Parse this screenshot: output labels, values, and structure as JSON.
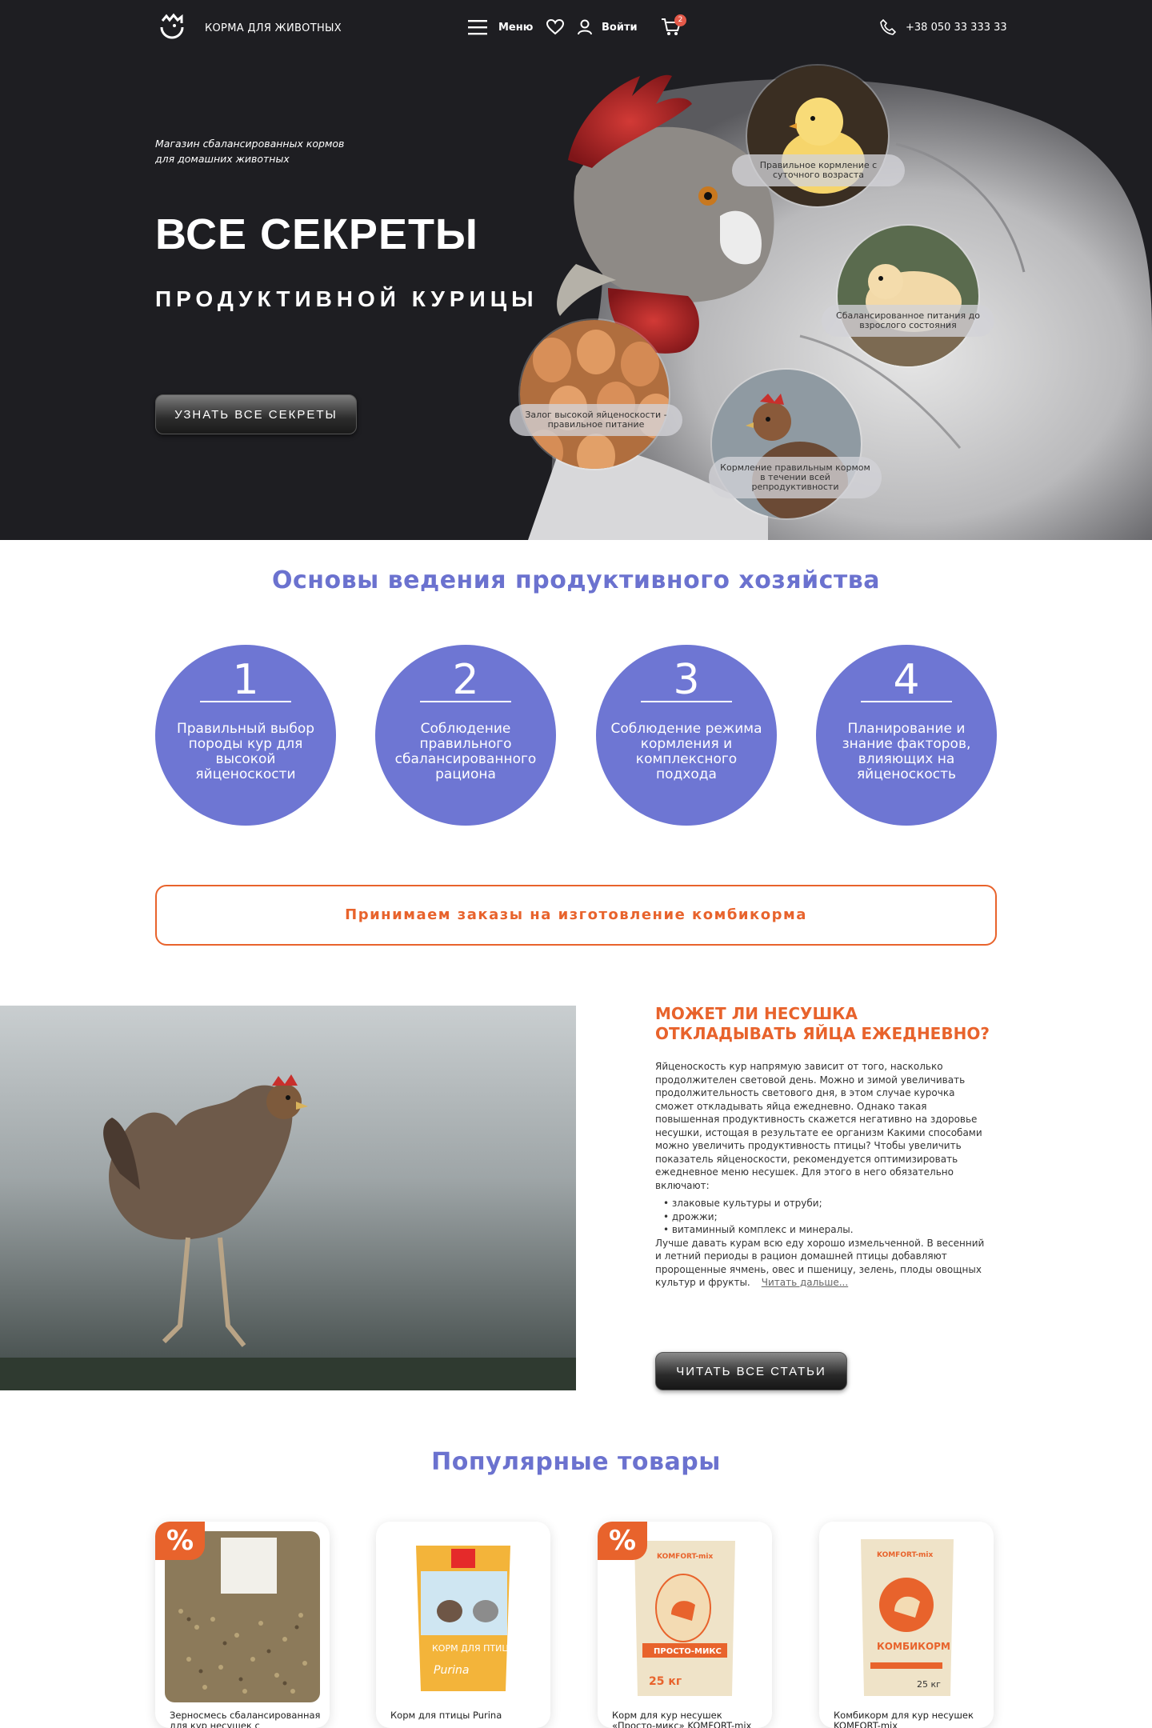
{
  "header": {
    "logo_text": "КОРМА ДЛЯ ЖИВОТНЫХ",
    "menu_label": "Меню",
    "login_label": "Войти",
    "cart_count": "2",
    "phone": "+38 050 33 333 33"
  },
  "hero": {
    "tagline": "Магазин сбалансированных кормов для домашних животных",
    "title": "ВСЕ СЕКРЕТЫ",
    "subtitle": "ПРОДУКТИВНОЙ КУРИЦЫ",
    "button": "УЗНАТЬ ВСЕ СЕКРЕТЫ",
    "bubbles": [
      "Правильное кормление с суточного возраста",
      "Сбалансированное питания до взрослого состояния",
      "Залог высокой яйценоскости - правильное питание",
      "Кормление правильным кормом в течении всей репродуктивности"
    ]
  },
  "basics": {
    "title": "Основы ведения продуктивного хозяйства",
    "steps": [
      {
        "num": "1",
        "text": "Правильный выбор породы кур для высокой яйценоскости"
      },
      {
        "num": "2",
        "text": "Соблюдение правильного сбалансированного рациона"
      },
      {
        "num": "3",
        "text": "Соблюдение режима кормления и комплексного подхода"
      },
      {
        "num": "4",
        "text": "Планирование и знание факторов, влияющих на яйценоскость"
      }
    ]
  },
  "orders_banner": "Принимаем заказы на изготовление комбикорма",
  "article": {
    "title": "МОЖЕТ ЛИ НЕСУШКА ОТКЛАДЫВАТЬ ЯЙЦА ЕЖЕДНЕВНО?",
    "p1": "Яйценоскость кур напрямую зависит от того, насколько продолжителен световой день. Можно и зимой увеличивать продолжительность светового дня, в этом случае курочка сможет откладывать яйца ежедневно. Однако такая повышенная продуктивность скажется негативно на здоровье несушки, истощая в результате ее организм Какими способами можно увеличить продуктивность птицы? Чтобы увеличить показатель яйценоскости, рекомендуется оптимизировать ежедневное меню несушек. Для этого в него обязательно включают:",
    "list": [
      "злаковые культуры и отруби;",
      "дрожжи;",
      "витаминный комплекс и минералы."
    ],
    "p2": "Лучше давать курам всю еду хорошо измельченной. В весенний и летний периоды в рацион домашней птицы добавляют пророщенные ячмень, овес и пшеницу, зелень, плоды овощных культур и фрукты.",
    "read_more": "Читать дальше...",
    "button": "ЧИТАТЬ ВСЕ СТАТЬИ"
  },
  "products": {
    "title": "Популярные товары",
    "sale_symbol": "%",
    "items": [
      {
        "name": "Зерносмесь сбалансированная для кур несушек с добавлением",
        "sale": true
      },
      {
        "name": "Корм для птицы Purina",
        "sale": false
      },
      {
        "name": "Корм для кур несушек «Просто-микс» KOMFORT-mix",
        "sale": true
      },
      {
        "name": "Комбикорм для кур несушек KOMFORT-mix",
        "sale": false
      }
    ],
    "bag_labels": {
      "purina_brand": "Purina",
      "purina_text": "КОРМ ДЛЯ ПТИЦЫ",
      "komfort_brand": "KOMFORT-mix",
      "prosto_text": "ПРОСТО-МИКС",
      "kombikorm_text": "КОМБИКОРМ",
      "weight": "25 кг"
    }
  },
  "colors": {
    "accent_orange": "#e8632c",
    "accent_purple": "#6e76d3",
    "hero_bg": "#1e1e22"
  }
}
